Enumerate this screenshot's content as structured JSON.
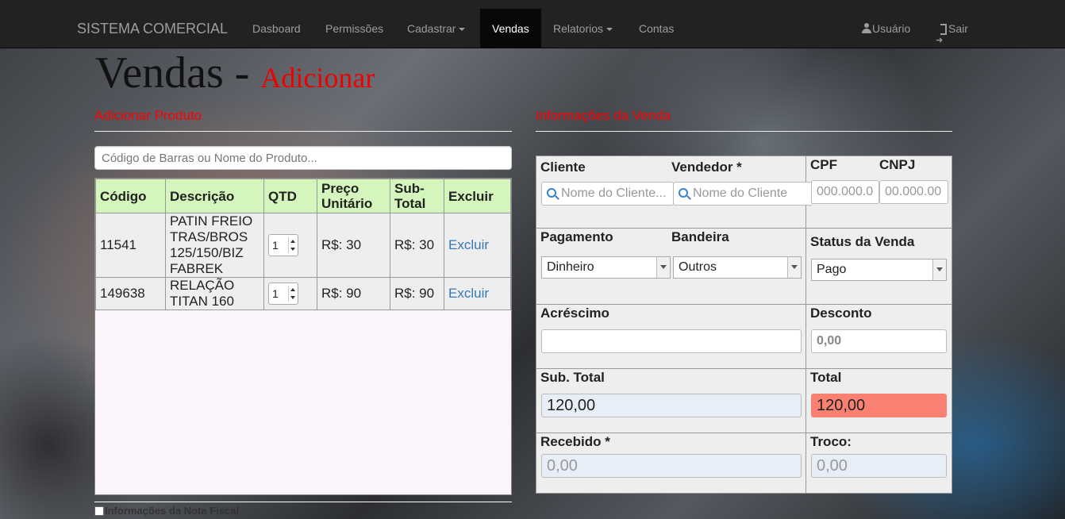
{
  "navbar": {
    "brand": "SISTEMA COMERCIAL",
    "items": [
      "Dasboard",
      "Permissões",
      "Cadastrar",
      "Vendas",
      "Relatorios",
      "Contas"
    ],
    "user": "Usuário",
    "logout": "Sair"
  },
  "page": {
    "title": "Vendas",
    "separator": " - ",
    "subtitle": "Adicionar"
  },
  "add_product": {
    "title": "Adicionar Produto",
    "search_placeholder": "Código de Barras ou Nome do Produto...",
    "headers": [
      "Código",
      "Descrição",
      "QTD",
      "Preço Unitário",
      "Sub-Total",
      "Excluir"
    ],
    "rows": [
      {
        "code": "11541",
        "desc": "PATIN FREIO TRAS/BROS 125/150/BIZ FABREK",
        "qty": "1",
        "price": "R$: 30",
        "subtotal": "R$: 30",
        "delete": "Excluir"
      },
      {
        "code": "149638",
        "desc": "RELAÇÃO TITAN 160",
        "qty": "1",
        "price": "R$: 90",
        "subtotal": "R$: 90",
        "delete": "Excluir"
      }
    ],
    "nota_fiscal": "Informações da Nota Fiscal"
  },
  "sale_info": {
    "title": "Informações da Venda",
    "cliente_label": "Cliente",
    "cliente_placeholder": "Nome do Cliente...",
    "vendedor_label": "Vendedor *",
    "vendedor_placeholder": "Nome do Cliente",
    "cpf_label": "CPF",
    "cpf_placeholder": "000.000.0",
    "cnpj_label": "CNPJ",
    "cnpj_placeholder": "00.000.00",
    "pagamento_label": "Pagamento",
    "pagamento_value": "Dinheiro",
    "bandeira_label": "Bandeira",
    "bandeira_value": "Outros",
    "status_label": "Status da Venda",
    "status_value": "Pago",
    "acrescimo_label": "Acréscimo",
    "acrescimo_value": "",
    "desconto_label": "Desconto",
    "desconto_value": "0,00",
    "subtotal_label": "Sub. Total",
    "subtotal_value": "120,00",
    "total_label": "Total",
    "total_value": "120,00",
    "recebido_label": "Recebido *",
    "recebido_value": "0,00",
    "troco_label": "Troco:",
    "troco_value": "0,00"
  },
  "colors": {
    "navbar": "#222222",
    "accent_red": "#ff0000",
    "table_header": "#d4f5bb",
    "total_bg": "#fa8072",
    "link": "#337ab7"
  }
}
